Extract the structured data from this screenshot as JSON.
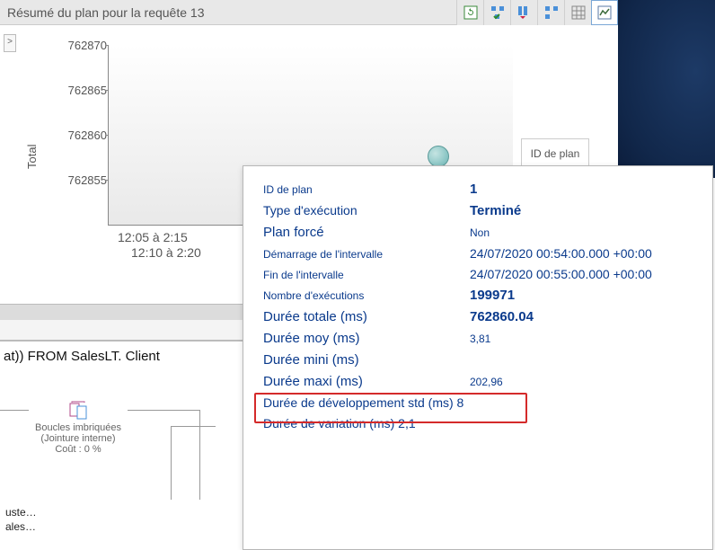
{
  "title": "Résumé du plan pour la requête 13",
  "side_label": "Total",
  "expander_glyph": ">",
  "chart_data": {
    "type": "scatter",
    "y_ticks": [
      762855,
      762860,
      762865,
      762870
    ],
    "x_labels": [
      "12:05 à 2:15",
      "12:10 à 2:20"
    ],
    "legend": "ID de plan",
    "points": [
      {
        "plan_id": 1,
        "x_bucket": "12:10 à 2:20",
        "y_value": 762860
      }
    ]
  },
  "sql_fragment": "at))   FROM SalesLT. Client",
  "plan_tree": {
    "node_title": "Boucles imbriquées",
    "node_sub": "(Jointure interne)",
    "node_cost": "Coût : 0   %",
    "leaf1": "  uste…",
    "leaf2": "ales…"
  },
  "tooltip": {
    "rows": [
      {
        "label": "ID de plan",
        "value": "1",
        "lclass": "small",
        "vclass": "bold"
      },
      {
        "label": "Type d'exécution",
        "value": "Terminé",
        "lclass": "",
        "vclass": "bold"
      },
      {
        "label": "Plan forcé",
        "value": "Non",
        "lclass": "big",
        "vclass": "small"
      },
      {
        "label": "Démarrage de l'intervalle",
        "value": " 24/07/2020 00:54:00.000 +00:00",
        "lclass": "small",
        "vclass": ""
      },
      {
        "label": "Fin de l'intervalle",
        "value": " 24/07/2020 00:55:00.000 +00:00",
        "lclass": "small",
        "vclass": ""
      },
      {
        "label": "Nombre d'exécutions",
        "value": "199971",
        "lclass": "small",
        "vclass": "bold"
      },
      {
        "label": "Durée totale (ms)",
        "value": "762860.04",
        "lclass": "big",
        "vclass": "bold"
      },
      {
        "label": "Durée moy (ms)",
        "value": "3,81",
        "lclass": "big",
        "vclass": "small"
      },
      {
        "label": "Durée mini (ms)",
        "value": "",
        "lclass": "big",
        "vclass": ""
      },
      {
        "label": "Durée maxi (ms)",
        "value": "202,96",
        "lclass": "big",
        "vclass": "small"
      },
      {
        "label": "Durée de développement std (ms)",
        "value": "8",
        "lclass": "",
        "vclass": "small inline"
      },
      {
        "label": "Durée de variation (ms)",
        "value": "2,1",
        "lclass": "",
        "vclass": "small inline"
      }
    ]
  }
}
